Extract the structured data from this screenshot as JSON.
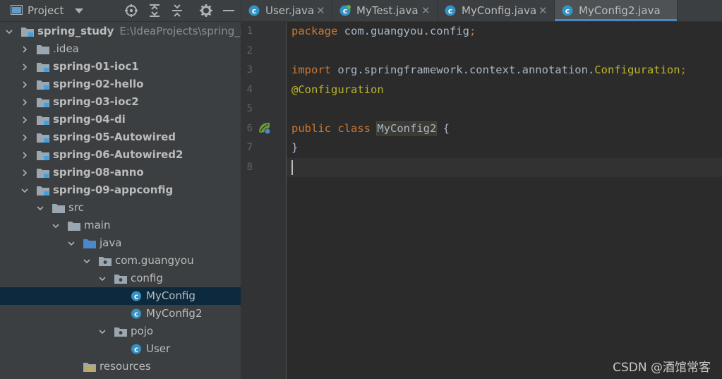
{
  "project": {
    "title": "Project",
    "tree": [
      {
        "label": "spring_study",
        "path": "E:\\IdeaProjects\\spring_stu",
        "bold": true,
        "level": 0,
        "kind": "module-root",
        "expanded": true
      },
      {
        "label": ".idea",
        "bold": false,
        "level": 1,
        "kind": "folder",
        "expanded": false
      },
      {
        "label": "spring-01-ioc1",
        "bold": true,
        "level": 1,
        "kind": "module",
        "expanded": false
      },
      {
        "label": "spring-02-hello",
        "bold": true,
        "level": 1,
        "kind": "module",
        "expanded": false
      },
      {
        "label": "spring-03-ioc2",
        "bold": true,
        "level": 1,
        "kind": "module",
        "expanded": false
      },
      {
        "label": "spring-04-di",
        "bold": true,
        "level": 1,
        "kind": "module",
        "expanded": false
      },
      {
        "label": "spring-05-Autowired",
        "bold": true,
        "level": 1,
        "kind": "module",
        "expanded": false
      },
      {
        "label": "spring-06-Autowired2",
        "bold": true,
        "level": 1,
        "kind": "module",
        "expanded": false
      },
      {
        "label": "spring-08-anno",
        "bold": true,
        "level": 1,
        "kind": "module",
        "expanded": false
      },
      {
        "label": "spring-09-appconfig",
        "bold": true,
        "level": 1,
        "kind": "module",
        "expanded": true
      },
      {
        "label": "src",
        "bold": false,
        "level": 2,
        "kind": "folder",
        "expanded": true
      },
      {
        "label": "main",
        "bold": false,
        "level": 3,
        "kind": "folder",
        "expanded": true
      },
      {
        "label": "java",
        "bold": false,
        "level": 4,
        "kind": "source-folder",
        "expanded": true
      },
      {
        "label": "com.guangyou",
        "bold": false,
        "level": 5,
        "kind": "package",
        "expanded": true
      },
      {
        "label": "config",
        "bold": false,
        "level": 6,
        "kind": "package",
        "expanded": true
      },
      {
        "label": "MyConfig",
        "bold": false,
        "level": 7,
        "kind": "class",
        "selected": true
      },
      {
        "label": "MyConfig2",
        "bold": false,
        "level": 7,
        "kind": "class"
      },
      {
        "label": "pojo",
        "bold": false,
        "level": 6,
        "kind": "package",
        "expanded": true
      },
      {
        "label": "User",
        "bold": false,
        "level": 7,
        "kind": "class"
      },
      {
        "label": "resources",
        "bold": false,
        "level": 4,
        "kind": "resources-folder"
      }
    ]
  },
  "tabs": [
    {
      "label": "User.java",
      "icon": "class-icon",
      "active": false
    },
    {
      "label": "MyTest.java",
      "icon": "test-class-icon",
      "active": false
    },
    {
      "label": "MyConfig.java",
      "icon": "class-icon",
      "active": false
    },
    {
      "label": "MyConfig2.java",
      "icon": "class-icon",
      "active": true
    }
  ],
  "editor": {
    "line_numbers": [
      "1",
      "2",
      "3",
      "4",
      "5",
      "6",
      "7",
      "8"
    ],
    "lines": [
      {
        "kw": "package",
        "rest": " com.guangyou.config",
        "semi": ";"
      },
      {},
      {
        "kw": "import",
        "rest": " org.springframework.context.annotation.",
        "ann": "Configuration",
        "semi": ";"
      },
      {
        "annotation": "@Configuration"
      },
      {},
      {
        "kw": "public class",
        "cls": "MyConfig2",
        "rest": " {"
      },
      {
        "rest": "}"
      },
      {
        "current": true
      }
    ]
  },
  "watermark": "CSDN @酒馆常客",
  "colors": {
    "keyword": "#cc7832",
    "annotation": "#bbb529",
    "selection": "#0d293e",
    "active_tab_underline": "#4a88c7"
  }
}
